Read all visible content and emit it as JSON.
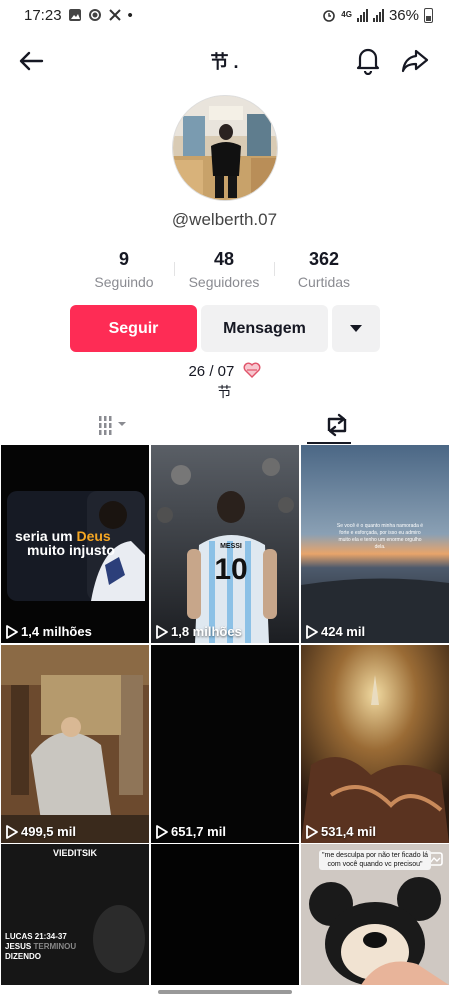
{
  "status_bar": {
    "time": "17:23",
    "dot": "•",
    "network": "4G",
    "battery": "36%"
  },
  "header": {
    "title": "节 ."
  },
  "profile": {
    "username": "@welberth.07",
    "stats": [
      {
        "value": "9",
        "label": "Seguindo"
      },
      {
        "value": "48",
        "label": "Seguidores"
      },
      {
        "value": "362",
        "label": "Curtidas"
      }
    ],
    "follow_label": "Seguir",
    "message_label": "Mensagem",
    "bio_line1": "26 / 07",
    "bio_line2": "节"
  },
  "colors": {
    "accent": "#fe2c55",
    "secondary_button": "#f1f1f2",
    "text": "#161823",
    "muted": "#8a8b91"
  },
  "tabs": [
    {
      "icon": "videos-grid-icon"
    },
    {
      "icon": "reposts-icon",
      "active": true
    }
  ],
  "videos": [
    {
      "views": "1,4 milhões",
      "caption_a": "seria um ",
      "caption_b": "Deus",
      "caption_c": "muito injusto"
    },
    {
      "views": "1,8 milhões",
      "jersey_name": "MESSI",
      "jersey_number": "10"
    },
    {
      "views": "424 mil",
      "caption": "Se você é o quanto minha namorada é forte e esforçada, por isso eu admiro muito ela e tenho um enorme orgulho dela."
    },
    {
      "views": "499,5 mil"
    },
    {
      "views": "651,7 mil"
    },
    {
      "views": "531,4 mil"
    },
    {
      "views": "",
      "top_text": "VIEDITSIK",
      "verse": "LUCAS 21:34-37",
      "line_a": "JESUS ",
      "line_b": "TERMINOU",
      "line_c": "DIZENDO"
    },
    {
      "views": ""
    },
    {
      "views": "",
      "caption": "\"me desculpa por não ter ficado lá com você quando vc precisou\""
    }
  ]
}
